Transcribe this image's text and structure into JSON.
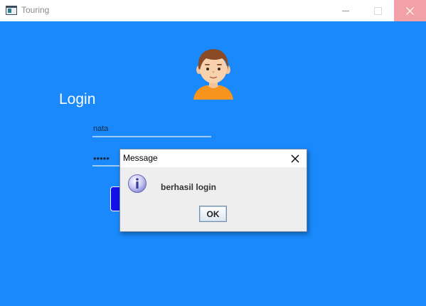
{
  "window": {
    "title": "Touring",
    "icon": "app-window-icon",
    "controls": [
      "minimize-icon",
      "maximize-icon",
      "close-icon"
    ]
  },
  "login": {
    "heading": "Login",
    "username_value": "nata",
    "password_masked": "•••••",
    "avatar_icon": "user-avatar-icon"
  },
  "dialog": {
    "title": "Message",
    "message": "berhasil login",
    "ok_label": "OK",
    "icon": "info-icon"
  },
  "colors": {
    "background": "#1989fb",
    "login_button": "#1212e8",
    "close_hover": "#f2a1a8"
  }
}
